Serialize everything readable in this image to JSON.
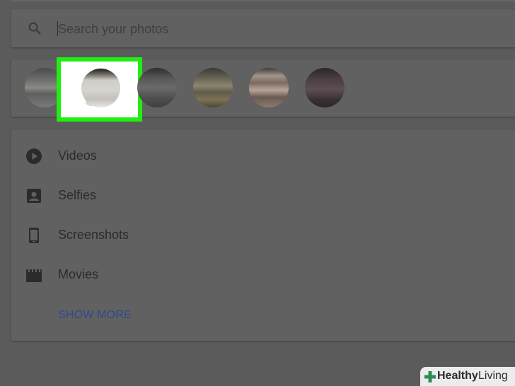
{
  "search": {
    "placeholder": "Search your photos"
  },
  "people": {
    "faces": [
      "face-1",
      "face-2",
      "face-3",
      "face-4",
      "face-5",
      "face-6"
    ],
    "highlight_color": "#22ee11",
    "highlighted_index": 2
  },
  "categories": {
    "items": [
      {
        "label": "Videos",
        "icon": "play-circle-icon"
      },
      {
        "label": "Selfies",
        "icon": "portrait-icon"
      },
      {
        "label": "Screenshots",
        "icon": "phone-icon"
      },
      {
        "label": "Movies",
        "icon": "clapperboard-icon"
      }
    ],
    "show_more_label": "SHOW MORE"
  },
  "watermark": {
    "brand_part_1": "Healthy",
    "brand_part_2": "Living",
    "accent_color": "#2e8b57"
  }
}
